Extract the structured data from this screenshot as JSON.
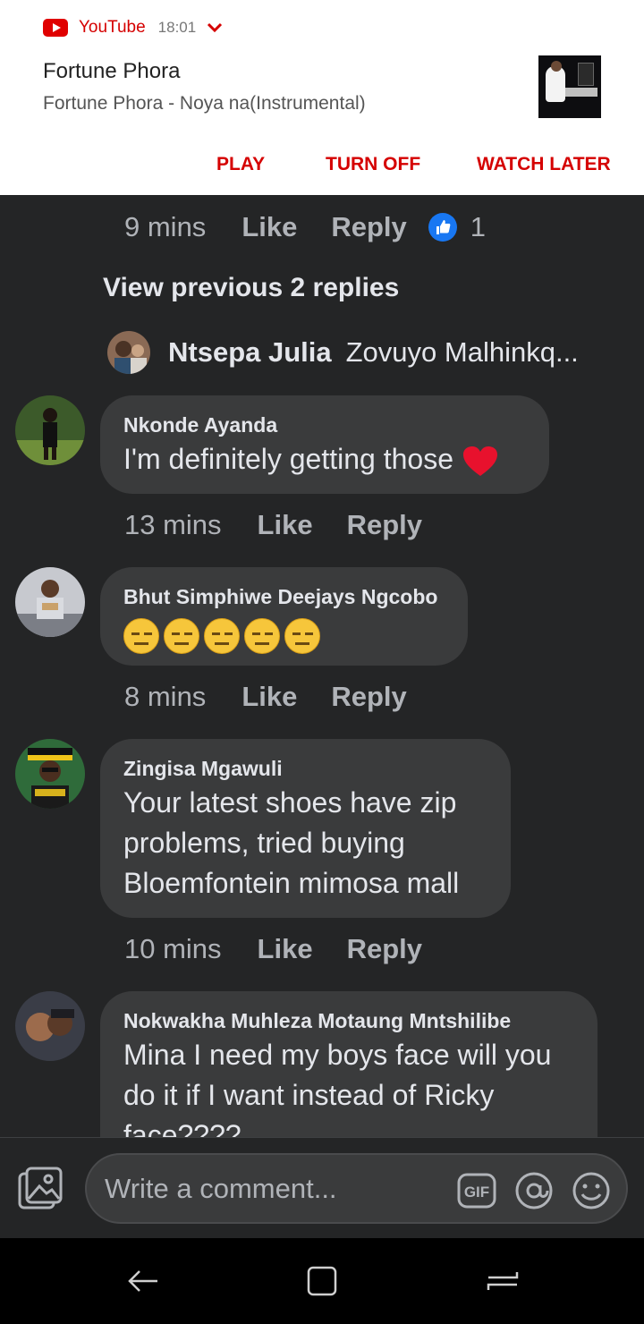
{
  "notification": {
    "app_name": "YouTube",
    "time": "18:01",
    "title": "Fortune Phora",
    "subtitle": "Fortune Phora - Noya na(Instrumental)",
    "actions": {
      "play": "PLAY",
      "turn_off": "TURN OFF",
      "watch_later": "WATCH LATER"
    },
    "brand_color": "#d50000"
  },
  "top_meta": {
    "time": "9 mins",
    "like": "Like",
    "reply": "Reply",
    "reaction_count": "1"
  },
  "view_previous": "View previous 2 replies",
  "reply_preview": {
    "name": "Ntsepa Julia",
    "snippet": "Zovuyo Malhinkq..."
  },
  "comments": [
    {
      "author": "Nkonde Ayanda",
      "text": "I'm definitely getting those",
      "time": "13 mins",
      "like": "Like",
      "reply": "Reply"
    },
    {
      "author": "Bhut Simphiwe Deejays Ngcobo",
      "time": "8 mins",
      "like": "Like",
      "reply": "Reply"
    },
    {
      "author": "Zingisa Mgawuli",
      "text": "Your latest shoes have zip problems,  tried buying Bloemfontein mimosa mall",
      "time": "10 mins",
      "like": "Like",
      "reply": "Reply"
    },
    {
      "author": "Nokwakha Muhleza Motaung Mntshilibe",
      "text": "Mina I need my boys face will you do it if I want instead of Ricky face????"
    }
  ],
  "composer": {
    "placeholder": "Write a comment..."
  },
  "theme": {
    "background": "#242526",
    "bubble": "#3a3b3c",
    "like_blue": "#1877f2"
  }
}
